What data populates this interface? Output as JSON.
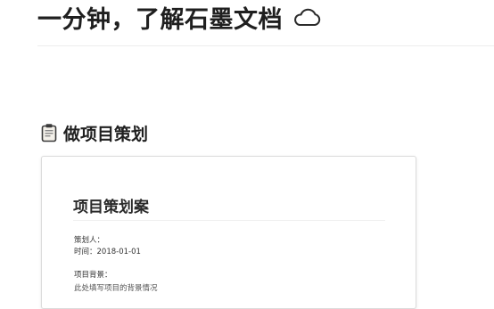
{
  "document": {
    "title": "一分钟，了解石墨文档",
    "sync_icon": "cloud-icon"
  },
  "section": {
    "icon": "clipboard-icon",
    "heading": "做项目策划"
  },
  "template_card": {
    "title": "项目策划案",
    "planner_label": "策划人：",
    "time_label": "时间：",
    "time_value": "2018-01-01",
    "background_label": "项目背景：",
    "background_text": "此处填写项目的背景情况"
  }
}
